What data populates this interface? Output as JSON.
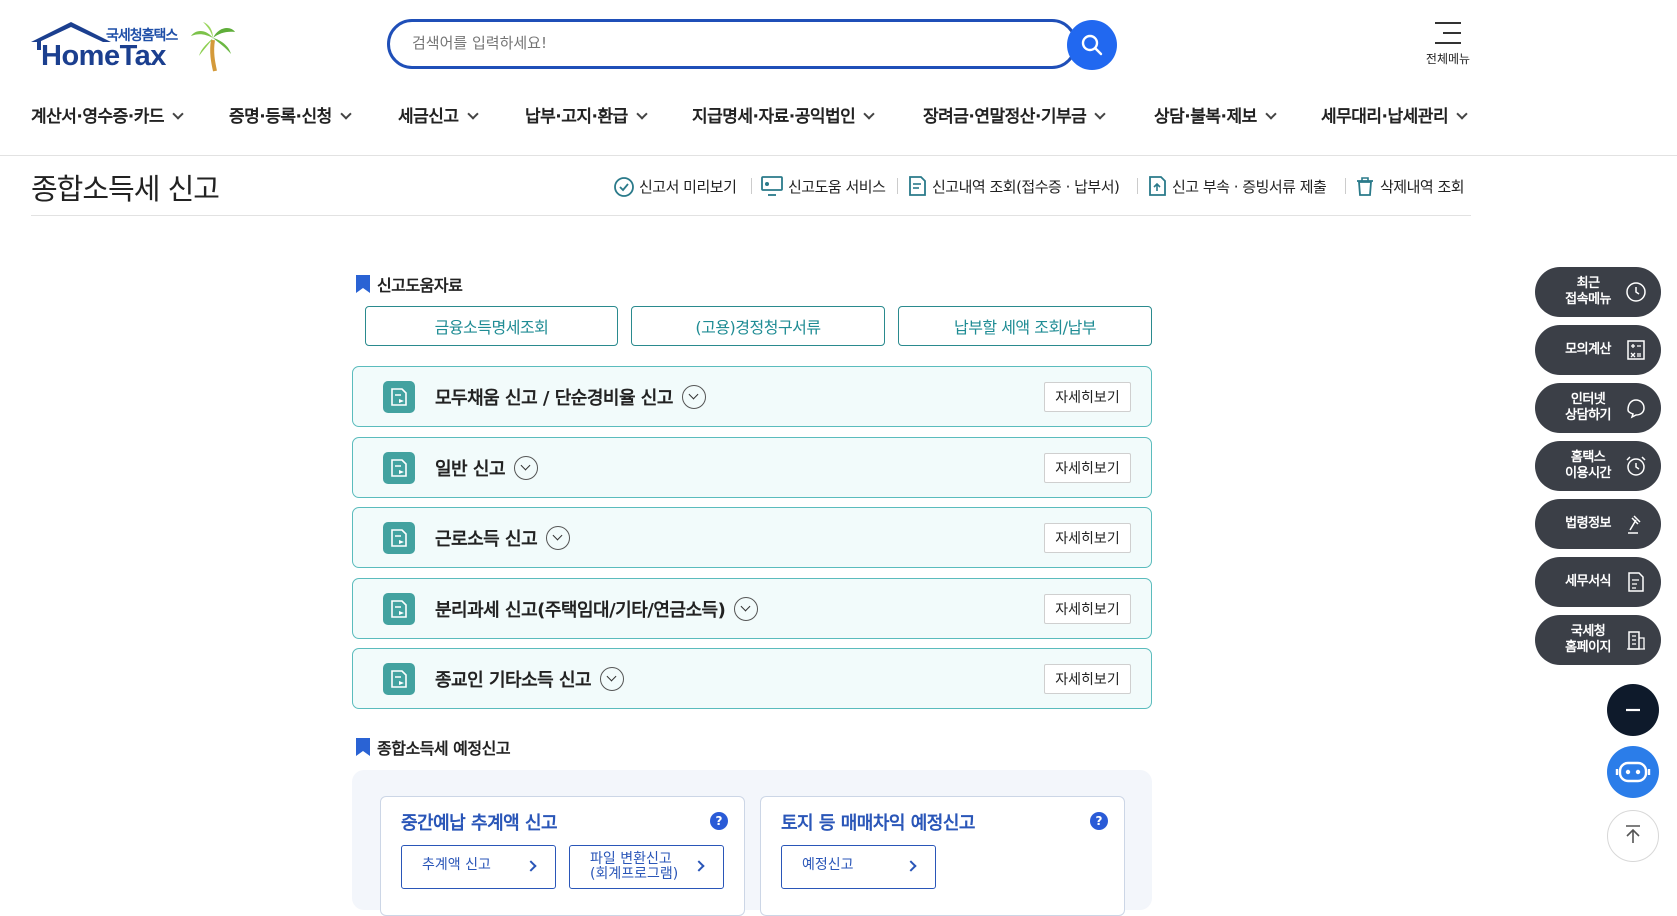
{
  "header": {
    "logo_sub": "국세청홈택스",
    "logo_main": "HomeTax",
    "search_placeholder": "검색어를 입력하세요!",
    "all_menu_label": "전체메뉴"
  },
  "gnb": [
    "계산서·영수증·카드",
    "증명·등록·신청",
    "세금신고",
    "납부·고지·환급",
    "지급명세·자료·공익법인",
    "장려금·연말정산·기부금",
    "상담·불복·제보",
    "세무대리·납세관리"
  ],
  "page": {
    "title": "종합소득세 신고",
    "quick_links": [
      "신고서 미리보기",
      "신고도움 서비스",
      "신고내역 조회(접수증 · 납부서)",
      "신고 부속 · 증빙서류 제출",
      "삭제내역 조회"
    ]
  },
  "help_section": {
    "heading": "신고도움자료",
    "buttons": [
      "금융소득명세조회",
      "(고용)경정청구서류",
      "납부할 세액 조회/납부"
    ]
  },
  "accordions": [
    {
      "label": "모두채움 신고 / 단순경비율 신고",
      "more": "자세히보기"
    },
    {
      "label": "일반 신고",
      "more": "자세히보기"
    },
    {
      "label": "근로소득 신고",
      "more": "자세히보기"
    },
    {
      "label": "분리과세 신고(주택임대/기타/연금소득)",
      "more": "자세히보기"
    },
    {
      "label": "종교인 기타소득 신고",
      "more": "자세히보기"
    }
  ],
  "estimated_section": {
    "heading": "종합소득세 예정신고",
    "cards": [
      {
        "title": "중간예납 추계액 신고",
        "help": "?",
        "buttons": [
          {
            "line1": "추계액 신고"
          },
          {
            "line1": "파일 변환신고",
            "line2": "(회계프로그램)"
          }
        ]
      },
      {
        "title": "토지 등 매매차익 예정신고",
        "help": "?",
        "buttons": [
          {
            "line1": "예정신고"
          }
        ]
      }
    ]
  },
  "right_quick": [
    {
      "line1": "최근",
      "line2": "접속메뉴",
      "icon": "clock-icon"
    },
    {
      "line1": "모의계산",
      "line2": "",
      "icon": "calculator-icon"
    },
    {
      "line1": "인터넷",
      "line2": "상담하기",
      "icon": "chat-icon"
    },
    {
      "line1": "홈택스",
      "line2": "이용시간",
      "icon": "alarm-icon"
    },
    {
      "line1": "법령정보",
      "line2": "",
      "icon": "gavel-icon"
    },
    {
      "line1": "세무서식",
      "line2": "",
      "icon": "form-icon"
    },
    {
      "line1": "국세청",
      "line2": "홈페이지",
      "icon": "building-icon"
    }
  ],
  "colors": {
    "brand_blue": "#1f4fb8",
    "search_button": "#2168f0",
    "teal": "#43a2a0",
    "quick_bar": "#3b3f47",
    "chatbot": "#2b7de9"
  }
}
